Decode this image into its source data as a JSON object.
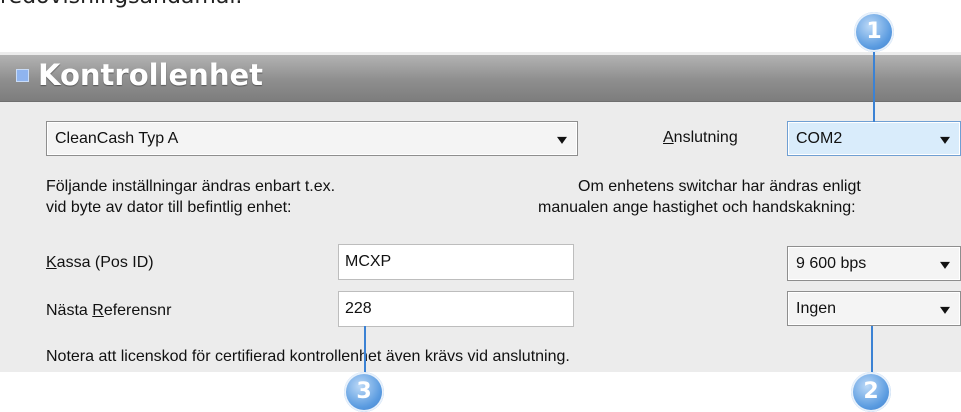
{
  "top_text": "redovisningsändamål.",
  "header": {
    "title": "Kontrollenhet"
  },
  "unit_select": {
    "value": "CleanCash Typ A"
  },
  "connection": {
    "label_pre": "",
    "label_u": "A",
    "label_post": "nslutning",
    "value": "COM2"
  },
  "info_left": {
    "line1": "Följande inställningar ändras enbart t.ex.",
    "line2": "vid byte av dator till befintlig enhet:"
  },
  "info_right": {
    "line1": "Om enhetens switchar har ändras enligt",
    "line2": "manualen ange hastighet och handskakning:"
  },
  "kassa": {
    "label_u": "K",
    "label_post": "assa (Pos ID)",
    "value": "MCXP"
  },
  "ref": {
    "label_pre": "Nästa ",
    "label_u": "R",
    "label_post": "eferensnr",
    "value": "228"
  },
  "speed_select": {
    "value": "9 600 bps"
  },
  "handshake_select": {
    "value": "Ingen"
  },
  "note": "Notera att licenskod för certifierad kontrollenhet även krävs vid anslutning.",
  "callouts": {
    "c1": "1",
    "c2": "2",
    "c3": "3"
  },
  "colors": {
    "accent": "#3b82d4",
    "header": "#8e8e8e",
    "panel": "#ececec"
  }
}
